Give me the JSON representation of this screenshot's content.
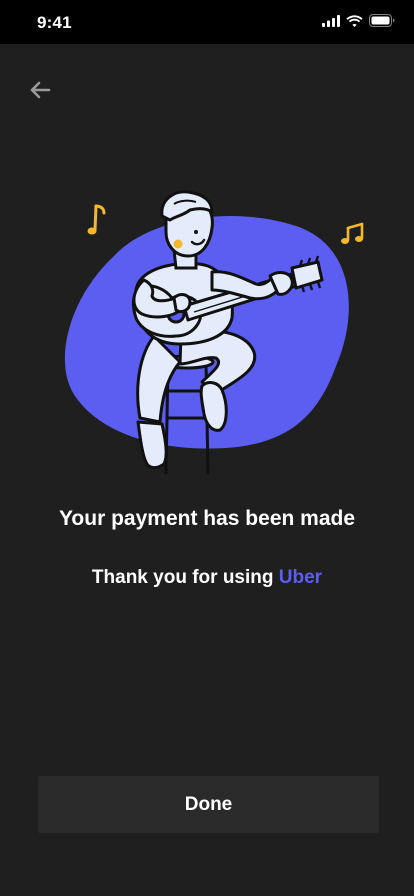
{
  "status_bar": {
    "time": "9:41",
    "icons": [
      "signal-icon",
      "wifi-icon",
      "battery-icon"
    ]
  },
  "navigation": {
    "back_icon": "arrow-left-icon"
  },
  "illustration": {
    "subject": "person-playing-guitar",
    "colors": {
      "blob": "#5b5ef0",
      "figure": "#e4ebfa",
      "outline": "#111111",
      "notes": "#f5b72b"
    }
  },
  "message": {
    "title": "Your payment has been made",
    "subtitle_prefix": "Thank you for using ",
    "brand": "Uber"
  },
  "actions": {
    "done_label": "Done"
  },
  "colors": {
    "background": "#1f1f1f",
    "status_bar": "#000000",
    "accent": "#5b5ef0",
    "button": "#2a2a2a"
  }
}
